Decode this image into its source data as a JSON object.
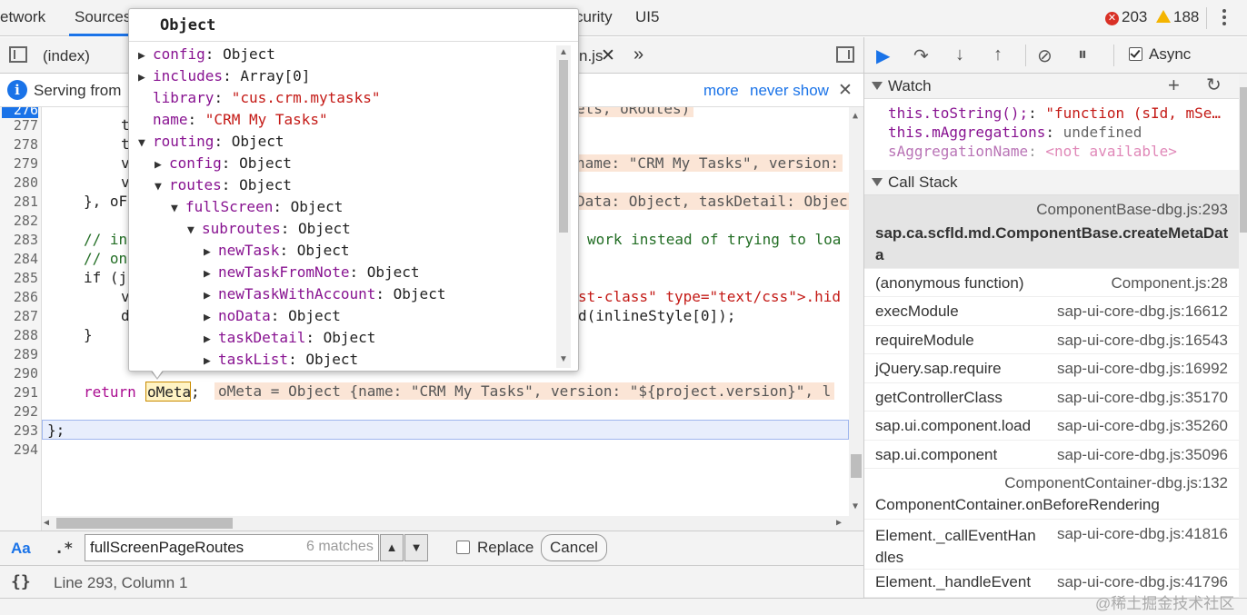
{
  "top_tabs": [
    "etwork",
    "Sources",
    "curity",
    "UI5"
  ],
  "errors": {
    "error_count": "203",
    "warning_count": "188"
  },
  "file_tabs": {
    "index": "(index)",
    "partial": "n.js"
  },
  "infobar": {
    "text": "Serving from",
    "more": "more",
    "never_show": "never show"
  },
  "lines": [
    "276",
    "277",
    "278",
    "279",
    "280",
    "281",
    "282",
    "283",
    "284",
    "285",
    "286",
    "287",
    "288",
    "289",
    "290",
    "291",
    "292",
    "293",
    "294"
  ],
  "code": {
    "l277": "t",
    "l278": "t",
    "l279": "v",
    "l280": "v",
    "l281": "}, oF",
    "l283a": "// in",
    "l283b": "work instead of trying to loa",
    "l284": "// on",
    "l285": "if (j",
    "l286a": "v",
    "l286b": "st-class\" type=\"text/css\">.hid",
    "l287a": "d",
    "l287b": "d(inlineStyle[0]);",
    "l288": "}",
    "l291_kw": "return",
    "l291_var": "oMeta",
    "l291_semi": ";",
    "l293": "};",
    "hint_276": "ets, oRoutes)",
    "hint_279": "name: \"CRM My Tasks\", version:",
    "hint_281": "Data: Object, taskDetail: Objec",
    "hint_291": "oMeta = Object {name: \"CRM My Tasks\", version: \"${project.version}\", l"
  },
  "popover": {
    "title": "Object",
    "items": [
      {
        "key": "config",
        "val": "Object",
        "toggle": "▶",
        "indent": 0,
        "str": false
      },
      {
        "key": "includes",
        "val": "Array[0]",
        "toggle": "▶",
        "indent": 0,
        "str": false
      },
      {
        "key": "library",
        "val": "\"cus.crm.mytasks\"",
        "toggle": "",
        "indent": 0,
        "str": true
      },
      {
        "key": "name",
        "val": "\"CRM My Tasks\"",
        "toggle": "",
        "indent": 0,
        "str": true
      },
      {
        "key": "routing",
        "val": "Object",
        "toggle": "▼",
        "indent": 0,
        "str": false
      },
      {
        "key": "config",
        "val": "Object",
        "toggle": "▶",
        "indent": 1,
        "str": false
      },
      {
        "key": "routes",
        "val": "Object",
        "toggle": "▼",
        "indent": 1,
        "str": false
      },
      {
        "key": "fullScreen",
        "val": "Object",
        "toggle": "▼",
        "indent": 2,
        "str": false
      },
      {
        "key": "subroutes",
        "val": "Object",
        "toggle": "▼",
        "indent": 3,
        "str": false
      },
      {
        "key": "newTask",
        "val": "Object",
        "toggle": "▶",
        "indent": 4,
        "str": false
      },
      {
        "key": "newTaskFromNote",
        "val": "Object",
        "toggle": "▶",
        "indent": 4,
        "str": false
      },
      {
        "key": "newTaskWithAccount",
        "val": "Object",
        "toggle": "▶",
        "indent": 4,
        "str": false
      },
      {
        "key": "noData",
        "val": "Object",
        "toggle": "▶",
        "indent": 4,
        "str": false
      },
      {
        "key": "taskDetail",
        "val": "Object",
        "toggle": "▶",
        "indent": 4,
        "str": false
      },
      {
        "key": "taskList",
        "val": "Object",
        "toggle": "▶",
        "indent": 4,
        "str": false
      }
    ]
  },
  "search": {
    "aa": "Aa",
    "regex": ".*",
    "value": "fullScreenPageRoutes",
    "matches": "6 matches",
    "replace": "Replace",
    "cancel": "Cancel"
  },
  "status": {
    "braces": "{}",
    "position": "Line 293, Column 1"
  },
  "debugger": {
    "async": "Async"
  },
  "watch": {
    "title": "Watch",
    "lines": [
      {
        "expr": "this.toString();",
        "sep": ": ",
        "val": "\"function (sId, mSe…",
        "kind": "str"
      },
      {
        "expr": "this.mAggregations",
        "sep": ": ",
        "val": "undefined",
        "kind": "undef"
      },
      {
        "expr": "sAggregationName",
        "sep": ": ",
        "val": "<not available>",
        "kind": "na"
      }
    ]
  },
  "callstack": {
    "title": "Call Stack",
    "frames": [
      {
        "fn": "sap.ca.scfld.md.ComponentBase.createMetaData",
        "loc": "ComponentBase-dbg.js:293"
      },
      {
        "fn": "(anonymous function)",
        "loc": "Component.js:28"
      },
      {
        "fn": "execModule",
        "loc": "sap-ui-core-dbg.js:16612"
      },
      {
        "fn": "requireModule",
        "loc": "sap-ui-core-dbg.js:16543"
      },
      {
        "fn": "jQuery.sap.require",
        "loc": "sap-ui-core-dbg.js:16992"
      },
      {
        "fn": "getControllerClass",
        "loc": "sap-ui-core-dbg.js:35170"
      },
      {
        "fn": "sap.ui.component.load",
        "loc": "sap-ui-core-dbg.js:35260"
      },
      {
        "fn": "sap.ui.component",
        "loc": "sap-ui-core-dbg.js:35096"
      },
      {
        "fn": "ComponentContainer.onBeforeRendering",
        "loc": "ComponentContainer-dbg.js:132"
      },
      {
        "fn": "Element._callEventHandles",
        "loc": "sap-ui-core-dbg.js:41816"
      },
      {
        "fn": "Element._handleEvent",
        "loc": "sap-ui-core-dbg.js:41796"
      }
    ]
  },
  "watermark": "@稀土掘金技术社区"
}
